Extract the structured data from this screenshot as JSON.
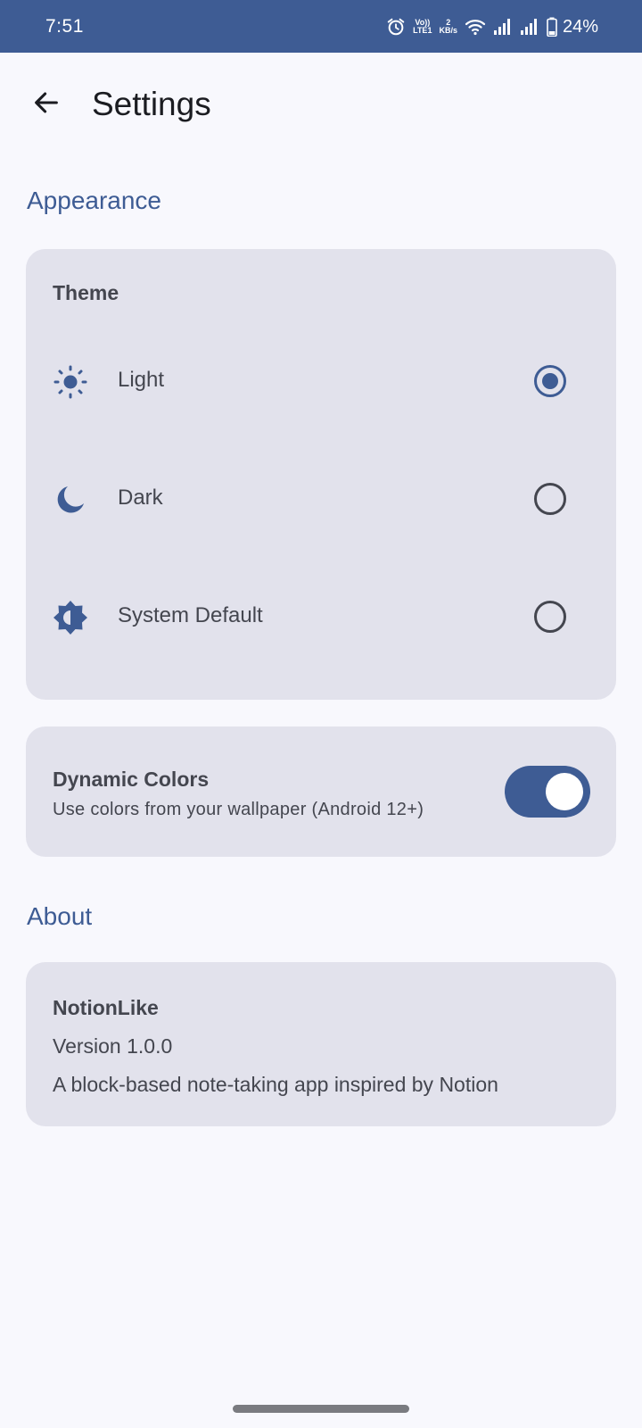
{
  "status_bar": {
    "time": "7:51",
    "volte_label_top": "Vo))",
    "volte_label_bottom": "LTE1",
    "speed_value": "2",
    "speed_unit": "KB/s",
    "battery_percent": "24%",
    "icons": [
      "alarm-icon",
      "volte-icon",
      "wifi-icon",
      "signal-icon",
      "signal-icon",
      "battery-icon"
    ]
  },
  "app_bar": {
    "title": "Settings",
    "back_icon": "arrow-back-icon"
  },
  "appearance": {
    "header": "Appearance",
    "theme": {
      "title": "Theme",
      "selected": "Light",
      "options": [
        {
          "label": "Light",
          "icon": "sun-icon",
          "selected": true
        },
        {
          "label": "Dark",
          "icon": "moon-icon",
          "selected": false
        },
        {
          "label": "System Default",
          "icon": "brightness-auto-icon",
          "selected": false
        }
      ]
    },
    "dynamic_colors": {
      "title": "Dynamic Colors",
      "subtitle": "Use colors from your wallpaper (Android 12+)",
      "enabled": true
    }
  },
  "about": {
    "header": "About",
    "app_name": "NotionLike",
    "version": "Version 1.0.0",
    "description": "A block-based note-taking app inspired by Notion"
  },
  "colors": {
    "primary": "#3e5c94",
    "background": "#f8f8fd",
    "card": "#e2e2ec",
    "text": "#44464f"
  }
}
